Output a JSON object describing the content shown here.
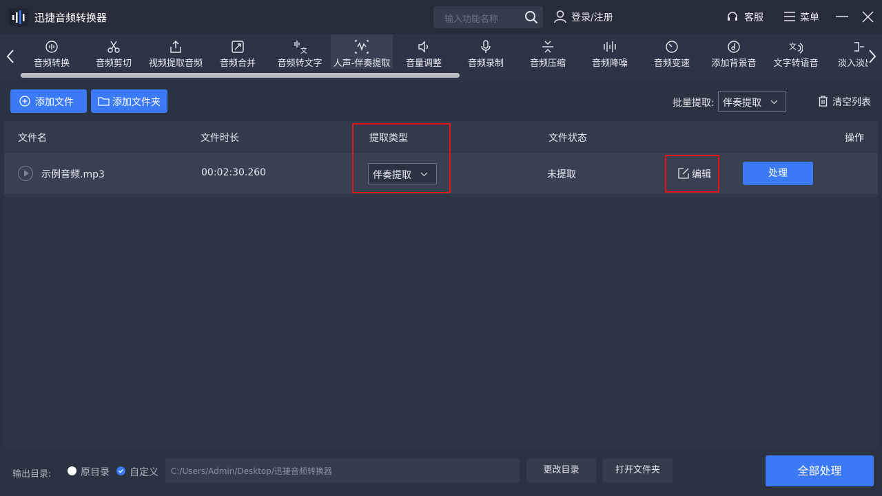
{
  "app": {
    "title": "迅捷音频转换器",
    "search_placeholder": "输入功能名称",
    "login_label": "登录/注册",
    "service_label": "客服",
    "menu_label": "菜单",
    "icons": {
      "logo": "waveform-logo-icon",
      "search": "search-icon",
      "user": "user-icon",
      "service": "headset-icon",
      "menu": "menu-icon",
      "minimize": "minimize-icon",
      "close": "close-icon"
    }
  },
  "functions": [
    {
      "label": "音频转换",
      "icon": "audio-convert-icon"
    },
    {
      "label": "音频剪切",
      "icon": "scissors-icon"
    },
    {
      "label": "视频提取音频",
      "icon": "upload-icon"
    },
    {
      "label": "音频合并",
      "icon": "merge-icon"
    },
    {
      "label": "音频转文字",
      "icon": "audio-to-text-icon"
    },
    {
      "label": "人声-伴奏提取",
      "icon": "vocal-extract-icon",
      "active": true
    },
    {
      "label": "音量调整",
      "icon": "speaker-icon"
    },
    {
      "label": "音频录制",
      "icon": "microphone-icon"
    },
    {
      "label": "音频压缩",
      "icon": "compress-icon"
    },
    {
      "label": "音频降噪",
      "icon": "denoise-icon"
    },
    {
      "label": "音频变速",
      "icon": "speed-icon"
    },
    {
      "label": "添加背景音",
      "icon": "music-note-icon"
    },
    {
      "label": "文字转语音",
      "icon": "text-to-speech-icon"
    },
    {
      "label": "淡入淡出",
      "icon": "fade-icon"
    }
  ],
  "toolbar": {
    "add_file": "添加文件",
    "add_folder": "添加文件夹",
    "batch_label": "批量提取:",
    "batch_value": "伴奏提取",
    "clear_list": "清空列表"
  },
  "table": {
    "headers": {
      "filename": "文件名",
      "duration": "文件时长",
      "type": "提取类型",
      "status": "文件状态",
      "action": "操作"
    },
    "rows": [
      {
        "filename": "示例音频.mp3",
        "duration": "00:02:30.260",
        "type": "伴奏提取",
        "status": "未提取",
        "edit": "编辑",
        "process": "处理"
      }
    ]
  },
  "footer": {
    "output_label": "输出目录:",
    "option_original": "原目录",
    "option_custom": "自定义",
    "selected_option": "自定义",
    "path": "C:/Users/Admin/Desktop/迅捷音频转换器",
    "change_dir": "更改目录",
    "open_folder": "打开文件夹",
    "process_all": "全部处理"
  },
  "colors": {
    "accent": "#3b79f5",
    "highlight": "#e01818",
    "background": "#2b3242"
  }
}
